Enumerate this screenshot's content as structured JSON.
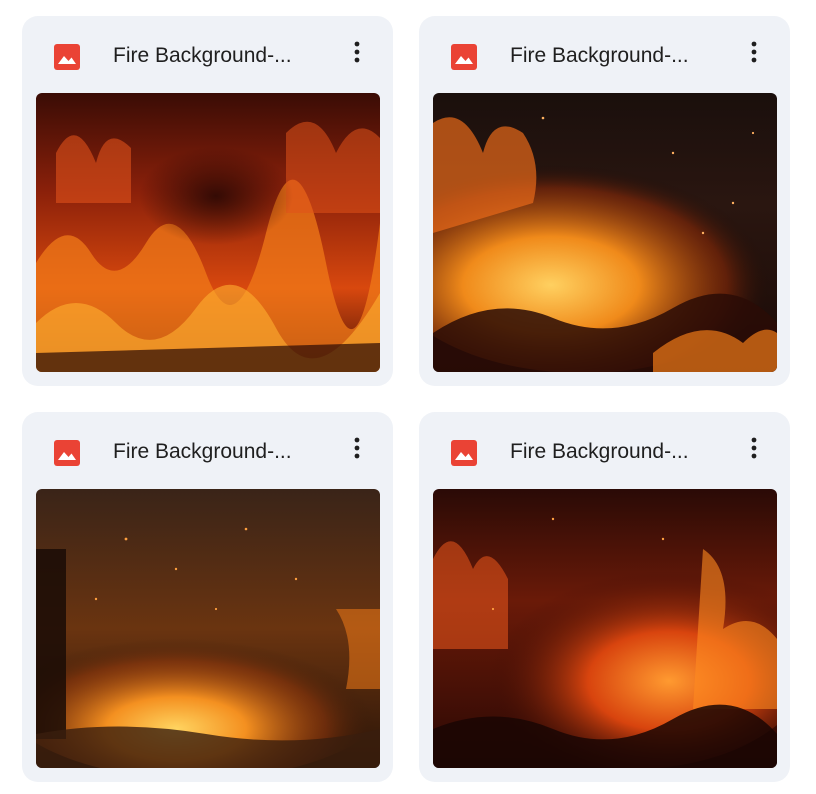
{
  "files": [
    {
      "name": "Fire Background-...",
      "type_icon": "image-file-icon",
      "menu_icon": "more-vert-icon"
    },
    {
      "name": "Fire Background-...",
      "type_icon": "image-file-icon",
      "menu_icon": "more-vert-icon"
    },
    {
      "name": "Fire Background-...",
      "type_icon": "image-file-icon",
      "menu_icon": "more-vert-icon"
    },
    {
      "name": "Fire Background-...",
      "type_icon": "image-file-icon",
      "menu_icon": "more-vert-icon"
    }
  ],
  "colors": {
    "card_bg": "#eff2f7",
    "image_icon": "#ea4335",
    "text": "#1f1f1f"
  }
}
